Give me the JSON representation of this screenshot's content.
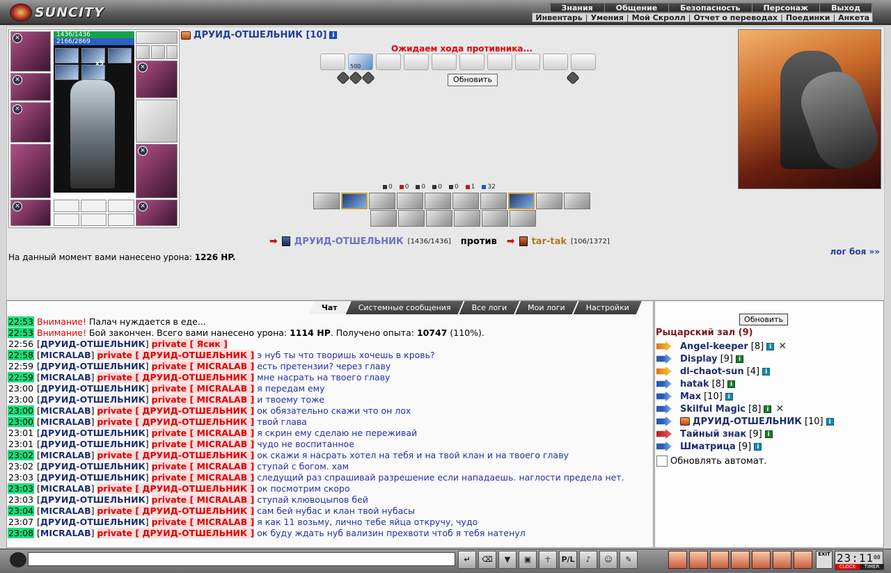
{
  "logo": {
    "text": "SUNCITY"
  },
  "menu": {
    "main": [
      "Знания",
      "Общение",
      "Безопасность",
      "Персонаж",
      "Выход"
    ],
    "sub": [
      "Инвентарь",
      "Умения",
      "Мой Скролл",
      "Отчет о переводах",
      "Поединки",
      "Анкета"
    ]
  },
  "character": {
    "hp": "1436/1436",
    "mp": "2166/2869",
    "buff_count": "x5",
    "name": "ДРУИД-ОТШЕЛЬНИК [10]",
    "info": "i"
  },
  "battle": {
    "status": "Ожидаем хода противника...",
    "scroll_number": "500",
    "refresh_label": "Обновить",
    "stats": [
      "0",
      "0",
      "0",
      "0",
      "0",
      "1",
      "32"
    ],
    "me_name": "ДРУИД-ОТШЕЛЬНИК",
    "me_hp": "[1436/1436]",
    "vs": "против",
    "op_name": "tar-tak",
    "op_hp": "[106/1372]",
    "damage_prefix": "На данный момент вами нанесено урона: ",
    "damage_value": "1226 HP.",
    "log_link": "лог боя »»"
  },
  "chat": {
    "tabs": [
      "Чат",
      "Системные сообщения",
      "Все логи",
      "Мои логи",
      "Настройки"
    ],
    "messages": [
      {
        "time": "22:53",
        "hl": true,
        "type": "warn",
        "label": "Внимание!",
        "text": " Палач нуждается в еде..."
      },
      {
        "time": "22:53",
        "hl": true,
        "type": "warn2",
        "label": "Внимание!",
        "text": " Бой закончен. Всего вами нанесено урона: ",
        "b1": "1114 HP",
        "t2": ". Получено опыта: ",
        "b2": "10747",
        "t3": " (110%)."
      },
      {
        "time": "22:56",
        "hl": false,
        "type": "priv",
        "nick": "ДРУИД-ОТШЕЛЬНИК",
        "priv": "private [ Ясик ]",
        "text": ""
      },
      {
        "time": "22:58",
        "hl": true,
        "type": "priv",
        "nick": "MICRALAB",
        "priv": "private [ ДРУИД-ОТШЕЛЬНИК ]",
        "text": "э нуб ты что творишь хочешь в кровь?"
      },
      {
        "time": "22:59",
        "hl": false,
        "type": "priv",
        "nick": "ДРУИД-ОТШЕЛЬНИК",
        "priv": "private [ MICRALAB ]",
        "text": "есть претензии? через главу"
      },
      {
        "time": "22:59",
        "hl": true,
        "type": "priv",
        "nick": "MICRALAB",
        "priv": "private [ ДРУИД-ОТШЕЛЬНИК ]",
        "text": "мне насрать на твоего главу"
      },
      {
        "time": "23:00",
        "hl": false,
        "type": "priv",
        "nick": "ДРУИД-ОТШЕЛЬНИК",
        "priv": "private [ MICRALAB ]",
        "text": "я передам ему"
      },
      {
        "time": "23:00",
        "hl": false,
        "type": "priv",
        "nick": "ДРУИД-ОТШЕЛЬНИК",
        "priv": "private [ MICRALAB ]",
        "text": "и твоему тоже"
      },
      {
        "time": "23:00",
        "hl": true,
        "type": "priv",
        "nick": "MICRALAB",
        "priv": "private [ ДРУИД-ОТШЕЛЬНИК ]",
        "text": "ок обязательно скажи что он лох"
      },
      {
        "time": "23:00",
        "hl": true,
        "type": "priv",
        "nick": "MICRALAB",
        "priv": "private [ ДРУИД-ОТШЕЛЬНИК ]",
        "text": "твой глава"
      },
      {
        "time": "23:01",
        "hl": false,
        "type": "priv",
        "nick": "ДРУИД-ОТШЕЛЬНИК",
        "priv": "private [ MICRALAB ]",
        "text": "я скрин ему сделаю не переживай"
      },
      {
        "time": "23:01",
        "hl": false,
        "type": "priv",
        "nick": "ДРУИД-ОТШЕЛЬНИК",
        "priv": "private [ MICRALAB ]",
        "text": "чудо не воспитанное"
      },
      {
        "time": "23:02",
        "hl": true,
        "type": "priv",
        "nick": "MICRALAB",
        "priv": "private [ ДРУИД-ОТШЕЛЬНИК ]",
        "text": "ок скажи я насрать хотел на тебя и на твой клан и на твоего главу"
      },
      {
        "time": "23:02",
        "hl": false,
        "type": "priv",
        "nick": "ДРУИД-ОТШЕЛЬНИК",
        "priv": "private [ MICRALAB ]",
        "text": "ступай с богом. хам"
      },
      {
        "time": "23:03",
        "hl": false,
        "type": "priv",
        "nick": "ДРУИД-ОТШЕЛЬНИК",
        "priv": "private [ MICRALAB ]",
        "text": "следущий раз спрашивай разрешение если нападаешь. наглости предела нет."
      },
      {
        "time": "23:03",
        "hl": true,
        "type": "priv",
        "nick": "MICRALAB",
        "priv": "private [ ДРУИД-ОТШЕЛЬНИК ]",
        "text": "ок посмотрим скоро"
      },
      {
        "time": "23:03",
        "hl": false,
        "type": "priv",
        "nick": "ДРУИД-ОТШЕЛЬНИК",
        "priv": "private [ MICRALAB ]",
        "text": "ступай клювоцыпов бей"
      },
      {
        "time": "23:04",
        "hl": true,
        "type": "priv",
        "nick": "MICRALAB",
        "priv": "private [ ДРУИД-ОТШЕЛЬНИК ]",
        "text": "сам бей нубас и клан твой нубасы"
      },
      {
        "time": "23:07",
        "hl": false,
        "type": "priv",
        "nick": "ДРУИД-ОТШЕЛЬНИК",
        "priv": "private [ MICRALAB ]",
        "text": "я как 11 возьму, лично тебе яйца откручу, чудо"
      },
      {
        "time": "23:08",
        "hl": true,
        "type": "priv",
        "nick": "MICRALAB",
        "priv": "private [ ДРУИД-ОТШЕЛЬНИК ]",
        "text": "ок буду ждать нуб вализин прехвоти чтоб я тебя натенул"
      }
    ]
  },
  "sidebar": {
    "refresh_label": "Обновить",
    "room": "Рыцарский зал (9)",
    "users": [
      {
        "name": "Angel-keeper",
        "lvl": "[8]",
        "icon": "fire",
        "x": true
      },
      {
        "name": "Display",
        "lvl": "[9]",
        "icon": "blue",
        "x": false
      },
      {
        "name": "dl-chaot-sun",
        "lvl": "[4]",
        "icon": "fire",
        "x": false
      },
      {
        "name": "hatak",
        "lvl": "[8]",
        "icon": "blue",
        "x": false
      },
      {
        "name": "Max",
        "lvl": "[10]",
        "icon": "blue",
        "x": false
      },
      {
        "name": "Skilful Magic",
        "lvl": "[8]",
        "icon": "blue",
        "x": true
      },
      {
        "name": "ДРУИД-ОТШЕЛЬНИК",
        "lvl": "[10]",
        "icon": "blue",
        "x": false
      },
      {
        "name": "Тайный знак",
        "lvl": "[9]",
        "icon": "red",
        "x": false
      },
      {
        "name": "Шматрица",
        "lvl": "[9]",
        "icon": "blue",
        "x": false
      }
    ],
    "auto_update": "Обновлять автомат."
  },
  "bottom": {
    "exit_label": "EXIT",
    "clock_time": "23:11",
    "clock_seconds": "00",
    "clock_label": "CLOCK",
    "timer_label": "TIMER",
    "tool_pl": "P/L"
  }
}
